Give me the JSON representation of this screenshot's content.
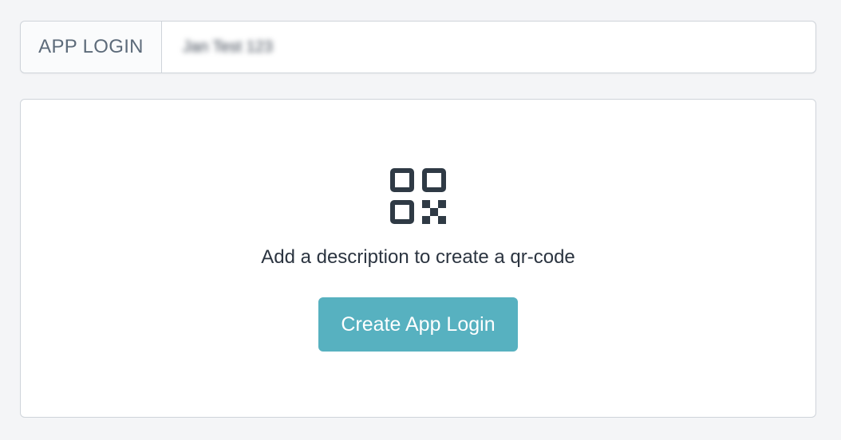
{
  "app_login": {
    "label": "APP LOGIN",
    "value": "Jan Test 123"
  },
  "card": {
    "icon": "qr-code-icon",
    "description": "Add a description to create a qr-code",
    "button_label": "Create App Login"
  },
  "colors": {
    "accent": "#57b1c0",
    "icon": "#2f3a45"
  }
}
